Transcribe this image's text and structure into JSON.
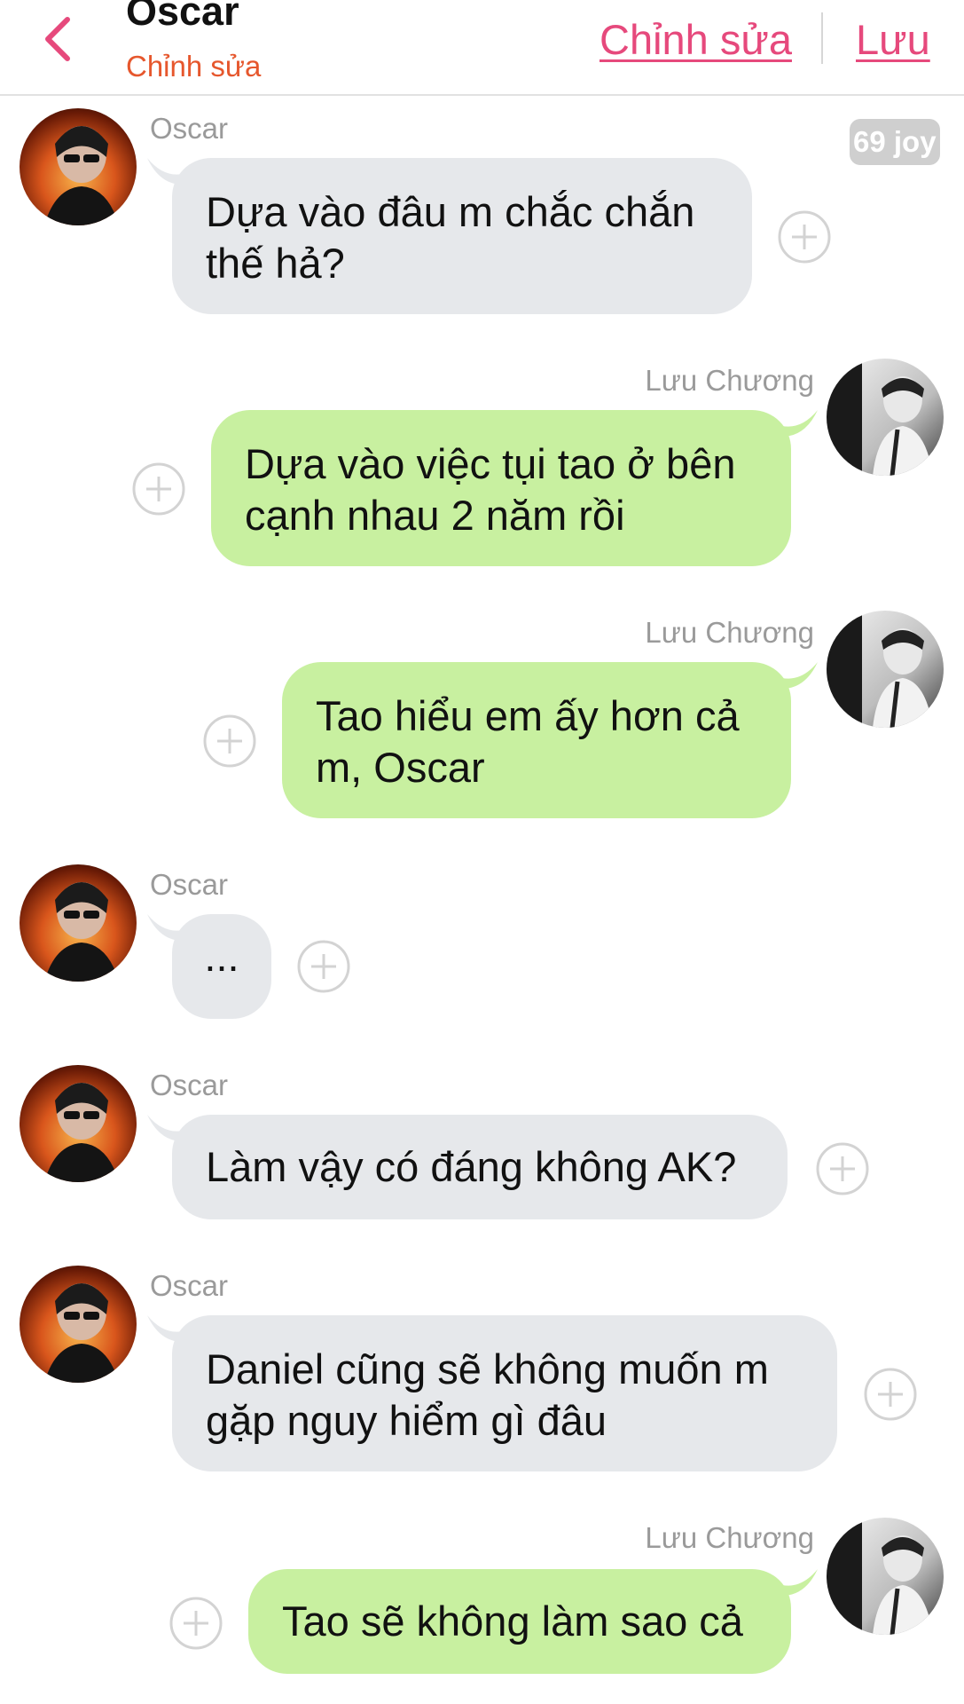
{
  "header": {
    "title": "Oscar",
    "subtitle": "Chỉnh sửa",
    "edit_label": "Chỉnh sửa",
    "save_label": "Lưu"
  },
  "colors": {
    "accent": "#e6497c",
    "subtitle": "#e6572d",
    "bubble_left": "#e6e8eb",
    "bubble_right": "#c8f0a0",
    "name_gray": "#9a9a9a"
  },
  "messages": [
    {
      "sender": "Oscar",
      "side": "left",
      "text": "Dựa vào đâu m chắc chắn\nthế hả?",
      "badge": "69 joy"
    },
    {
      "sender": "Lưu Chương",
      "side": "right",
      "text": "Dựa vào việc tụi tao ở bên\ncạnh nhau 2 năm rồi"
    },
    {
      "sender": "Lưu Chương",
      "side": "right",
      "text": "Tao hiểu em ấy hơn cả\nm, Oscar"
    },
    {
      "sender": "Oscar",
      "side": "left",
      "text": "..."
    },
    {
      "sender": "Oscar",
      "side": "left",
      "text": "Làm vậy có đáng không AK?"
    },
    {
      "sender": "Oscar",
      "side": "left",
      "text": "Daniel cũng sẽ không muốn m\ngặp nguy hiểm gì đâu"
    },
    {
      "sender": "Lưu Chương",
      "side": "right",
      "text": "Tao sẽ không làm sao cả"
    }
  ],
  "icons": {
    "back": "chevron-left-icon",
    "add_reaction": "plus-circle-icon"
  }
}
